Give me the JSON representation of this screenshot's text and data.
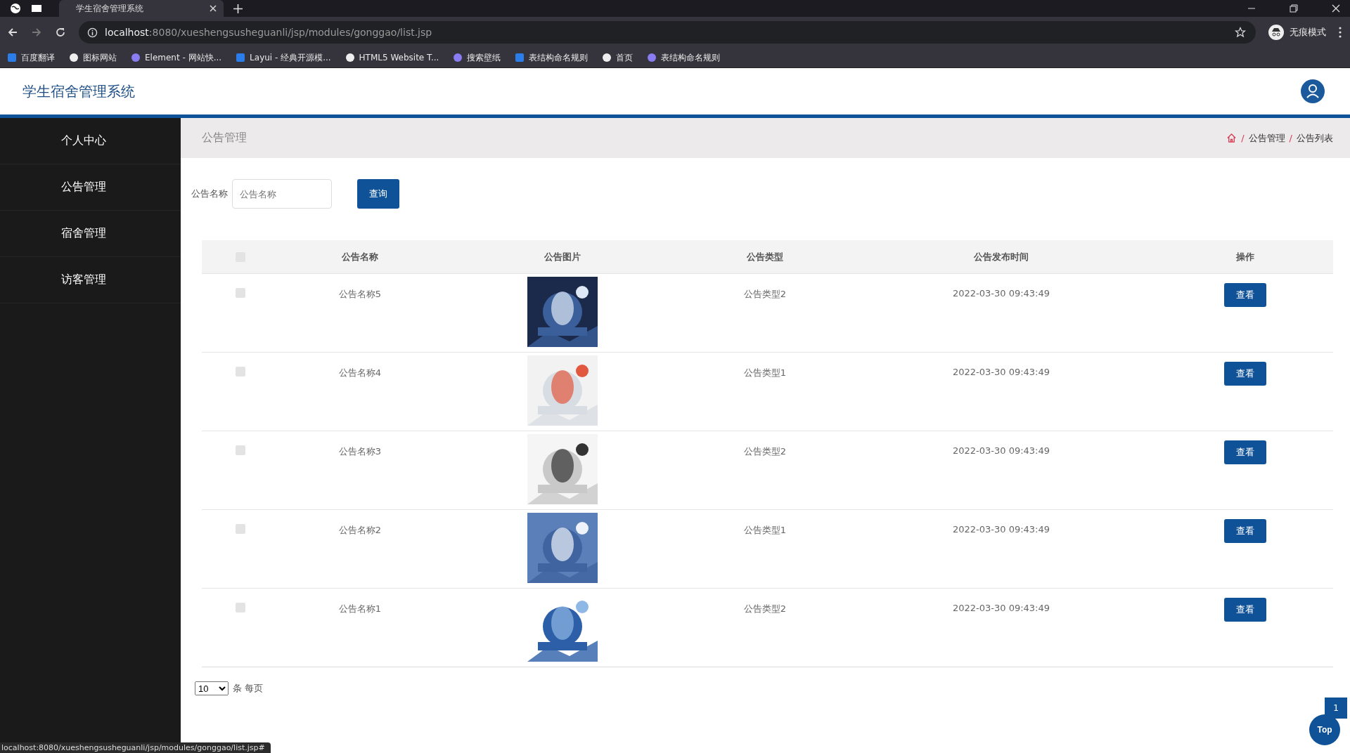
{
  "browser": {
    "tab_title": "学生宿舍管理系统",
    "url_host": "localhost",
    "url_rest": ":8080/xueshengsusheguanli/jsp/modules/gonggao/list.jsp",
    "incognito_label": "无痕模式",
    "bookmarks": [
      "百度翻译",
      "图标网站",
      "Element - 网站快...",
      "Layui - 经典开源模...",
      "HTML5 Website T...",
      "搜索壁纸",
      "表结构命名规则",
      "首页",
      "表结构命名规则"
    ]
  },
  "header": {
    "title": "学生宿舍管理系统"
  },
  "sidebar": {
    "items": [
      "个人中心",
      "公告管理",
      "宿舍管理",
      "访客管理"
    ]
  },
  "page_title": "公告管理",
  "breadcrumb": [
    "公告管理",
    "公告列表"
  ],
  "breadcrumb_separator": "/",
  "search": {
    "label": "公告名称",
    "placeholder": "公告名称",
    "button": "查询"
  },
  "table": {
    "select_all_checked": false,
    "columns": [
      "公告名称",
      "公告图片",
      "公告类型",
      "公告发布时间",
      "操作"
    ],
    "rows": [
      {
        "checked": false,
        "name": "公告名称5",
        "type": "公告类型2",
        "time": "2022-03-30 09:43:49",
        "action": "查看"
      },
      {
        "checked": false,
        "name": "公告名称4",
        "type": "公告类型1",
        "time": "2022-03-30 09:43:49",
        "action": "查看"
      },
      {
        "checked": false,
        "name": "公告名称3",
        "type": "公告类型2",
        "time": "2022-03-30 09:43:49",
        "action": "查看"
      },
      {
        "checked": false,
        "name": "公告名称2",
        "type": "公告类型1",
        "time": "2022-03-30 09:43:49",
        "action": "查看"
      },
      {
        "checked": false,
        "name": "公告名称1",
        "type": "公告类型2",
        "time": "2022-03-30 09:43:49",
        "action": "查看"
      }
    ]
  },
  "pagination": {
    "page_size": "10",
    "suffix": "条 每页"
  },
  "page_badge": "1",
  "top_button": "Top",
  "status_url": "localhost:8080/xueshengsusheguanli/jsp/modules/gonggao/list.jsp#"
}
